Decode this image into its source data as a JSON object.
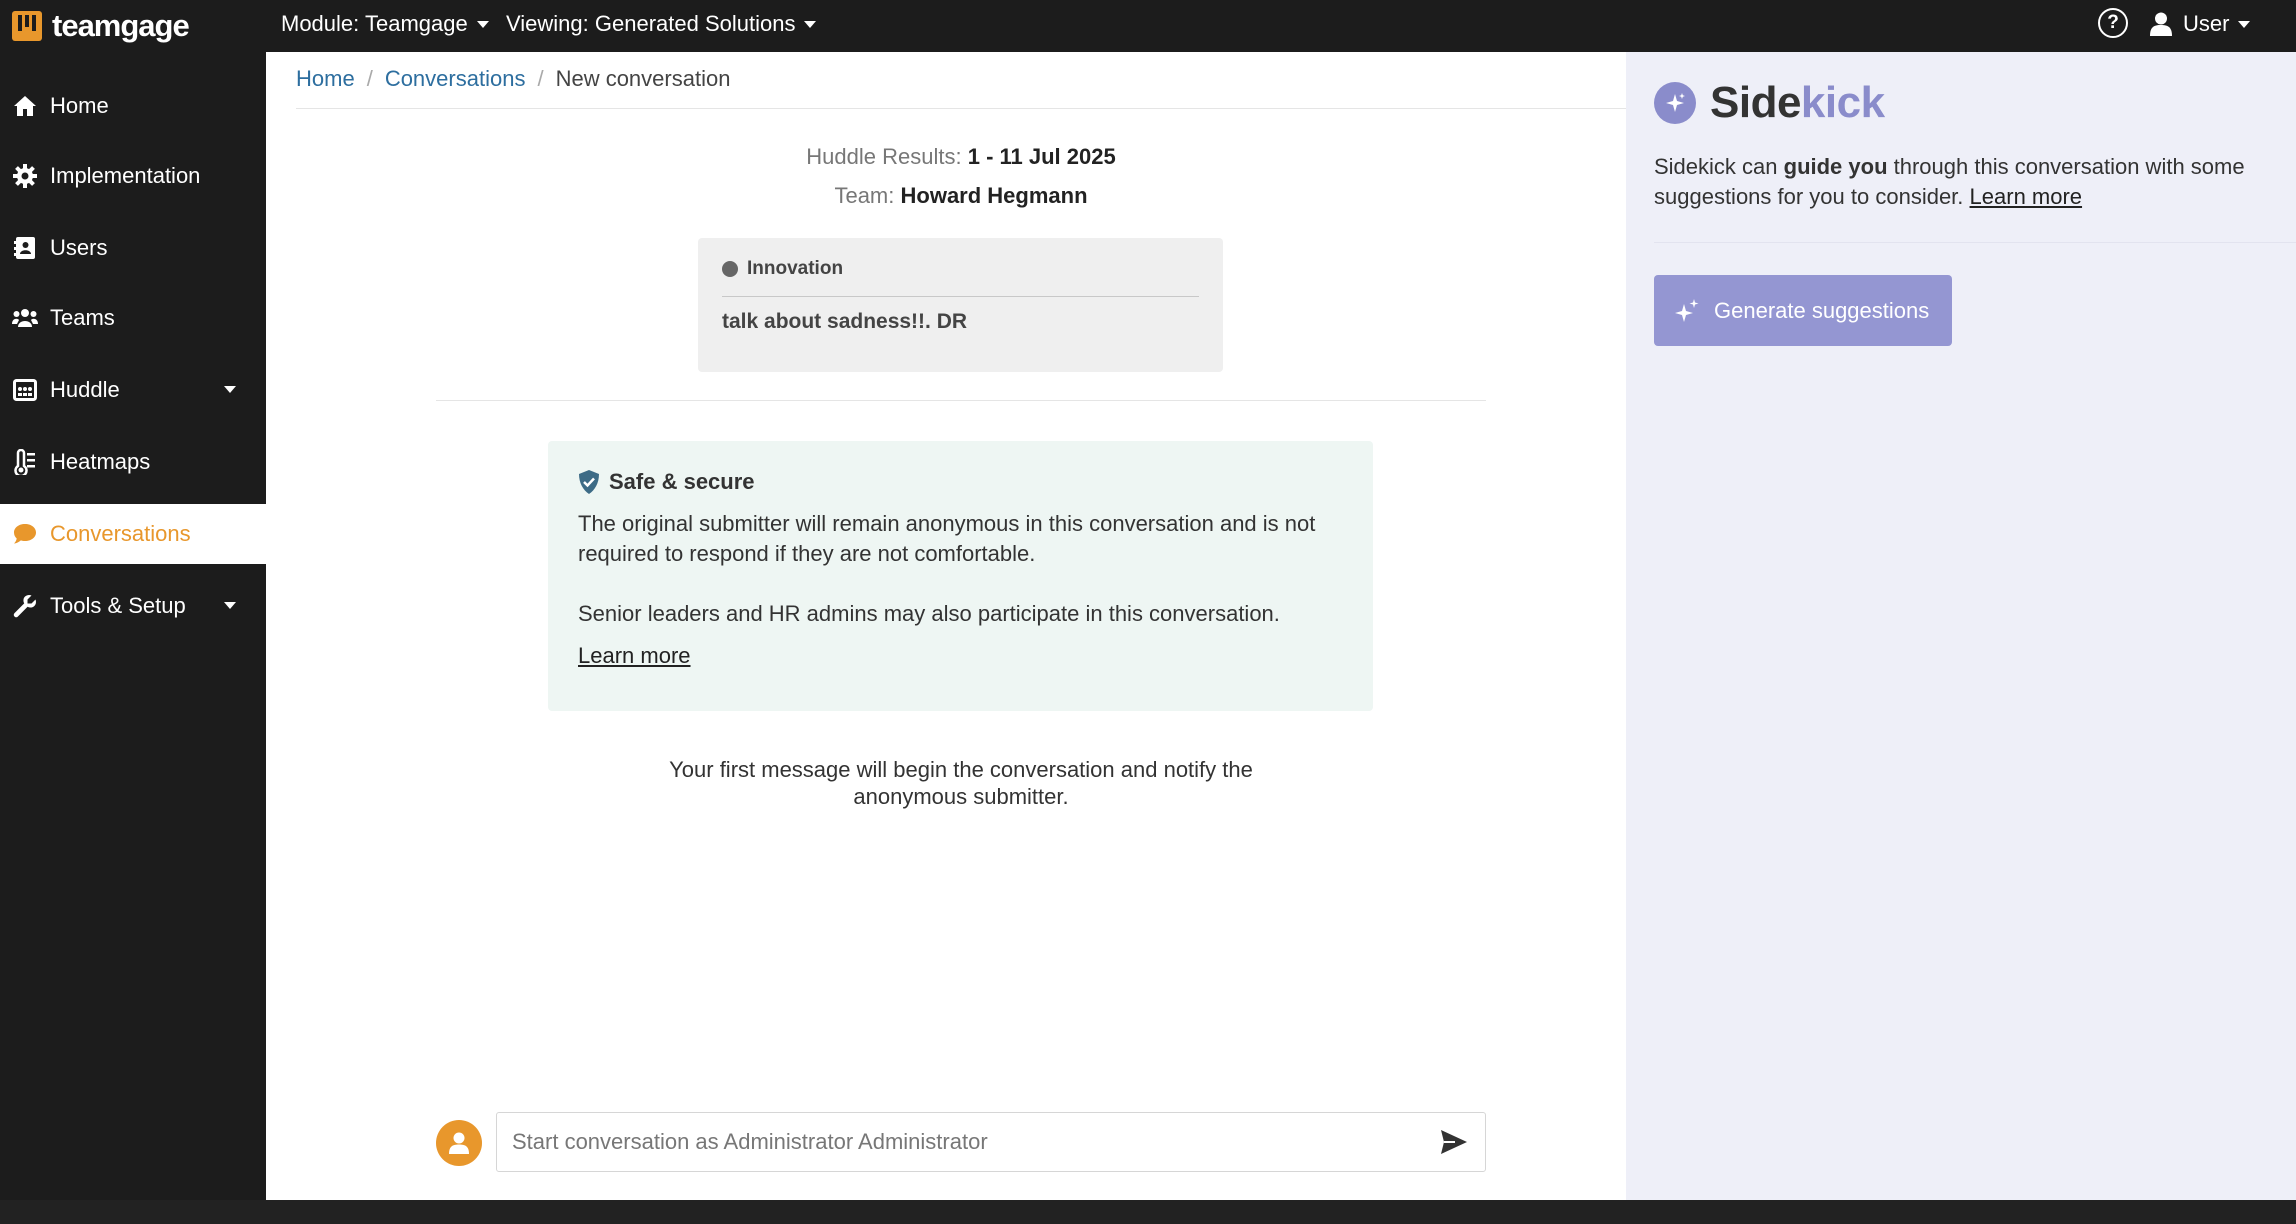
{
  "app": {
    "name": "teamgage"
  },
  "topbar": {
    "module_label": "Module: Teamgage",
    "viewing_label": "Viewing: Generated Solutions",
    "help_glyph": "?",
    "user_label": "User"
  },
  "sidebar": {
    "items": [
      {
        "label": "Home",
        "icon": "home-icon"
      },
      {
        "label": "Implementation",
        "icon": "gear-icon"
      },
      {
        "label": "Users",
        "icon": "address-card-icon"
      },
      {
        "label": "Teams",
        "icon": "users-icon"
      },
      {
        "label": "Huddle",
        "icon": "huddle-icon"
      },
      {
        "label": "Heatmaps",
        "icon": "thermometer-icon"
      },
      {
        "label": "Conversations",
        "icon": "comment-icon"
      },
      {
        "label": "Tools & Setup",
        "icon": "wrench-icon"
      }
    ],
    "active": "Conversations",
    "active_color": "#e8972c"
  },
  "breadcrumb": {
    "home": "Home",
    "conversations": "Conversations",
    "current": "New conversation"
  },
  "huddle": {
    "results_label": "Huddle Results:",
    "results_value": "1 - 11 Jul 2025",
    "team_label": "Team:",
    "team_value": "Howard Hegmann"
  },
  "topic": {
    "category": "Innovation",
    "text": "talk about sadness!!. DR"
  },
  "safe": {
    "title": "Safe & secure",
    "para1": "The original submitter will remain anonymous in this conversation and is not required to respond if they are not comfortable.",
    "para2": "Senior leaders and HR admins may also participate in this conversation.",
    "link": "Learn more"
  },
  "first_message_note": "Your first message will begin the conversation and notify the anonymous submitter.",
  "composer": {
    "placeholder": "Start conversation as Administrator Administrator"
  },
  "sidekick": {
    "title_a": "Side",
    "title_b": "kick",
    "desc_prefix": "Sidekick can ",
    "desc_bold": "guide you",
    "desc_suffix": " through this conversation with some suggestions for you to consider. ",
    "desc_link": "Learn more",
    "button_label": "Generate suggestions",
    "accent": "#8a8ccb"
  }
}
